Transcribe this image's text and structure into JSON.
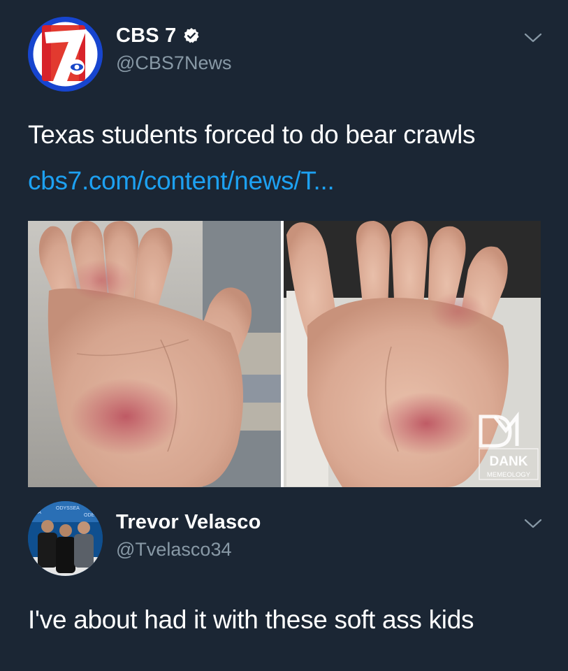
{
  "colors": {
    "background": "#1b2634",
    "text_primary": "#ffffff",
    "text_secondary": "#8899a6",
    "link": "#1da1f2",
    "verified_badge": "#ffffff"
  },
  "tweet": {
    "author": {
      "display_name": "CBS 7",
      "handle": "@CBS7News",
      "verified": true,
      "avatar_icon": "cbs7-logo-icon",
      "logo_text": "7"
    },
    "text": "Texas students forced to do bear crawls",
    "link_text": "cbs7.com/content/news/T...",
    "media": {
      "description_icon": "photo",
      "watermark_line1": "DANK",
      "watermark_line2": "MEMEOLOGY"
    },
    "menu_icon": "chevron-down-icon"
  },
  "reply": {
    "author": {
      "display_name": "Trevor Velasco",
      "handle": "@Tvelasco34",
      "avatar_icon": "profile-photo-icon"
    },
    "text": "I've about had it with these soft ass kids",
    "menu_icon": "chevron-down-icon"
  }
}
